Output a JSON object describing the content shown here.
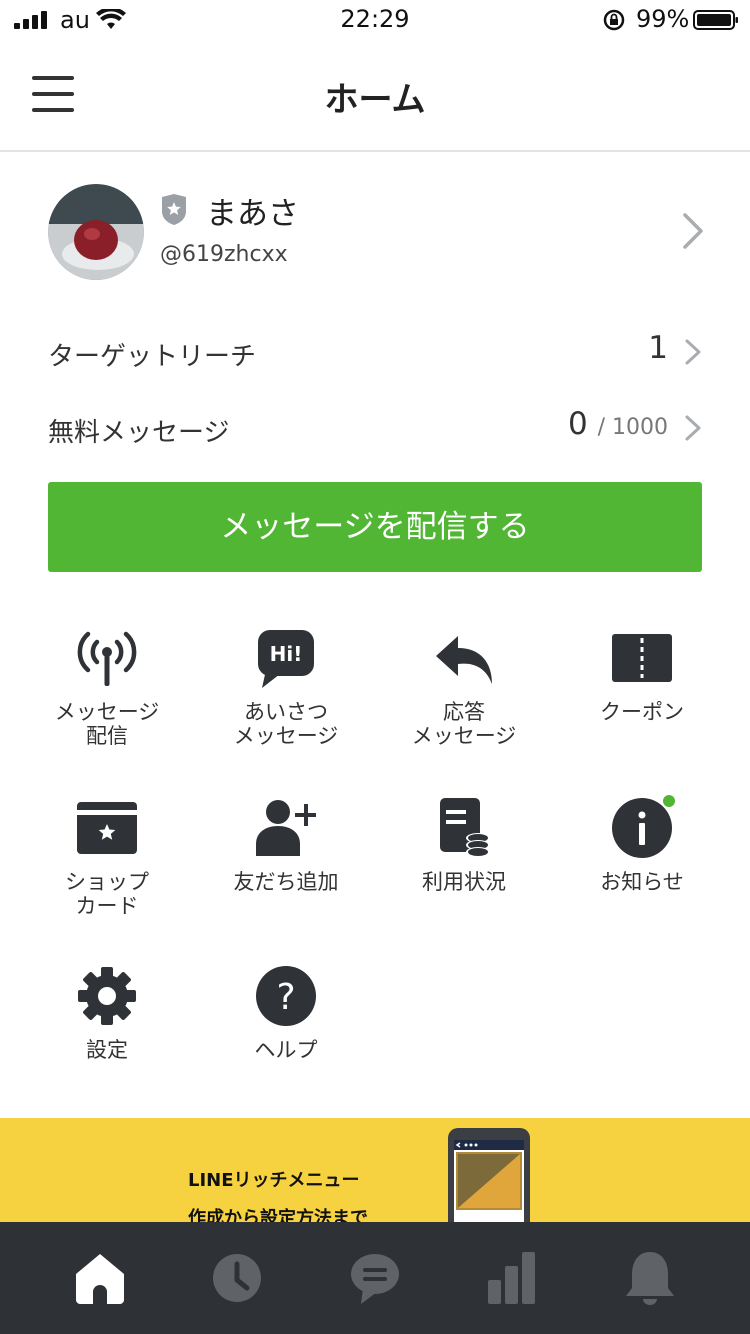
{
  "status": {
    "carrier": "au",
    "time": "22:29",
    "battery": "99%"
  },
  "header": {
    "title": "ホーム"
  },
  "profile": {
    "name": "まあさ",
    "id": "@619zhcxx"
  },
  "stats": {
    "target_label": "ターゲットリーチ",
    "target_value": "1",
    "free_label": "無料メッセージ",
    "free_value": "0",
    "free_limit": "/ 1000"
  },
  "cta_label": "メッセージを配信する",
  "menu": [
    {
      "label": "メッセージ\n配信",
      "icon": "broadcast-icon"
    },
    {
      "label": "あいさつ\nメッセージ",
      "icon": "hi-bubble-icon"
    },
    {
      "label": "応答\nメッセージ",
      "icon": "reply-icon"
    },
    {
      "label": "クーポン",
      "icon": "coupon-icon"
    },
    {
      "label": "ショップ\nカード",
      "icon": "shop-card-icon"
    },
    {
      "label": "友だち追加",
      "icon": "add-friend-icon"
    },
    {
      "label": "利用状況",
      "icon": "usage-icon"
    },
    {
      "label": "お知らせ",
      "icon": "info-icon"
    },
    {
      "label": "設定",
      "icon": "gear-icon"
    },
    {
      "label": "ヘルプ",
      "icon": "help-icon"
    }
  ],
  "banner": {
    "line1": "LINEリッチメニュー",
    "line2": "作成から設定方法まで"
  },
  "tabs": [
    "home-icon",
    "clock-icon",
    "chat-icon",
    "stats-icon",
    "bell-icon"
  ],
  "colors": {
    "accent_green": "#52b635",
    "tabbar_bg": "#2e3136",
    "banner_bg": "#f6d240",
    "icon_dark": "#2f3237"
  }
}
